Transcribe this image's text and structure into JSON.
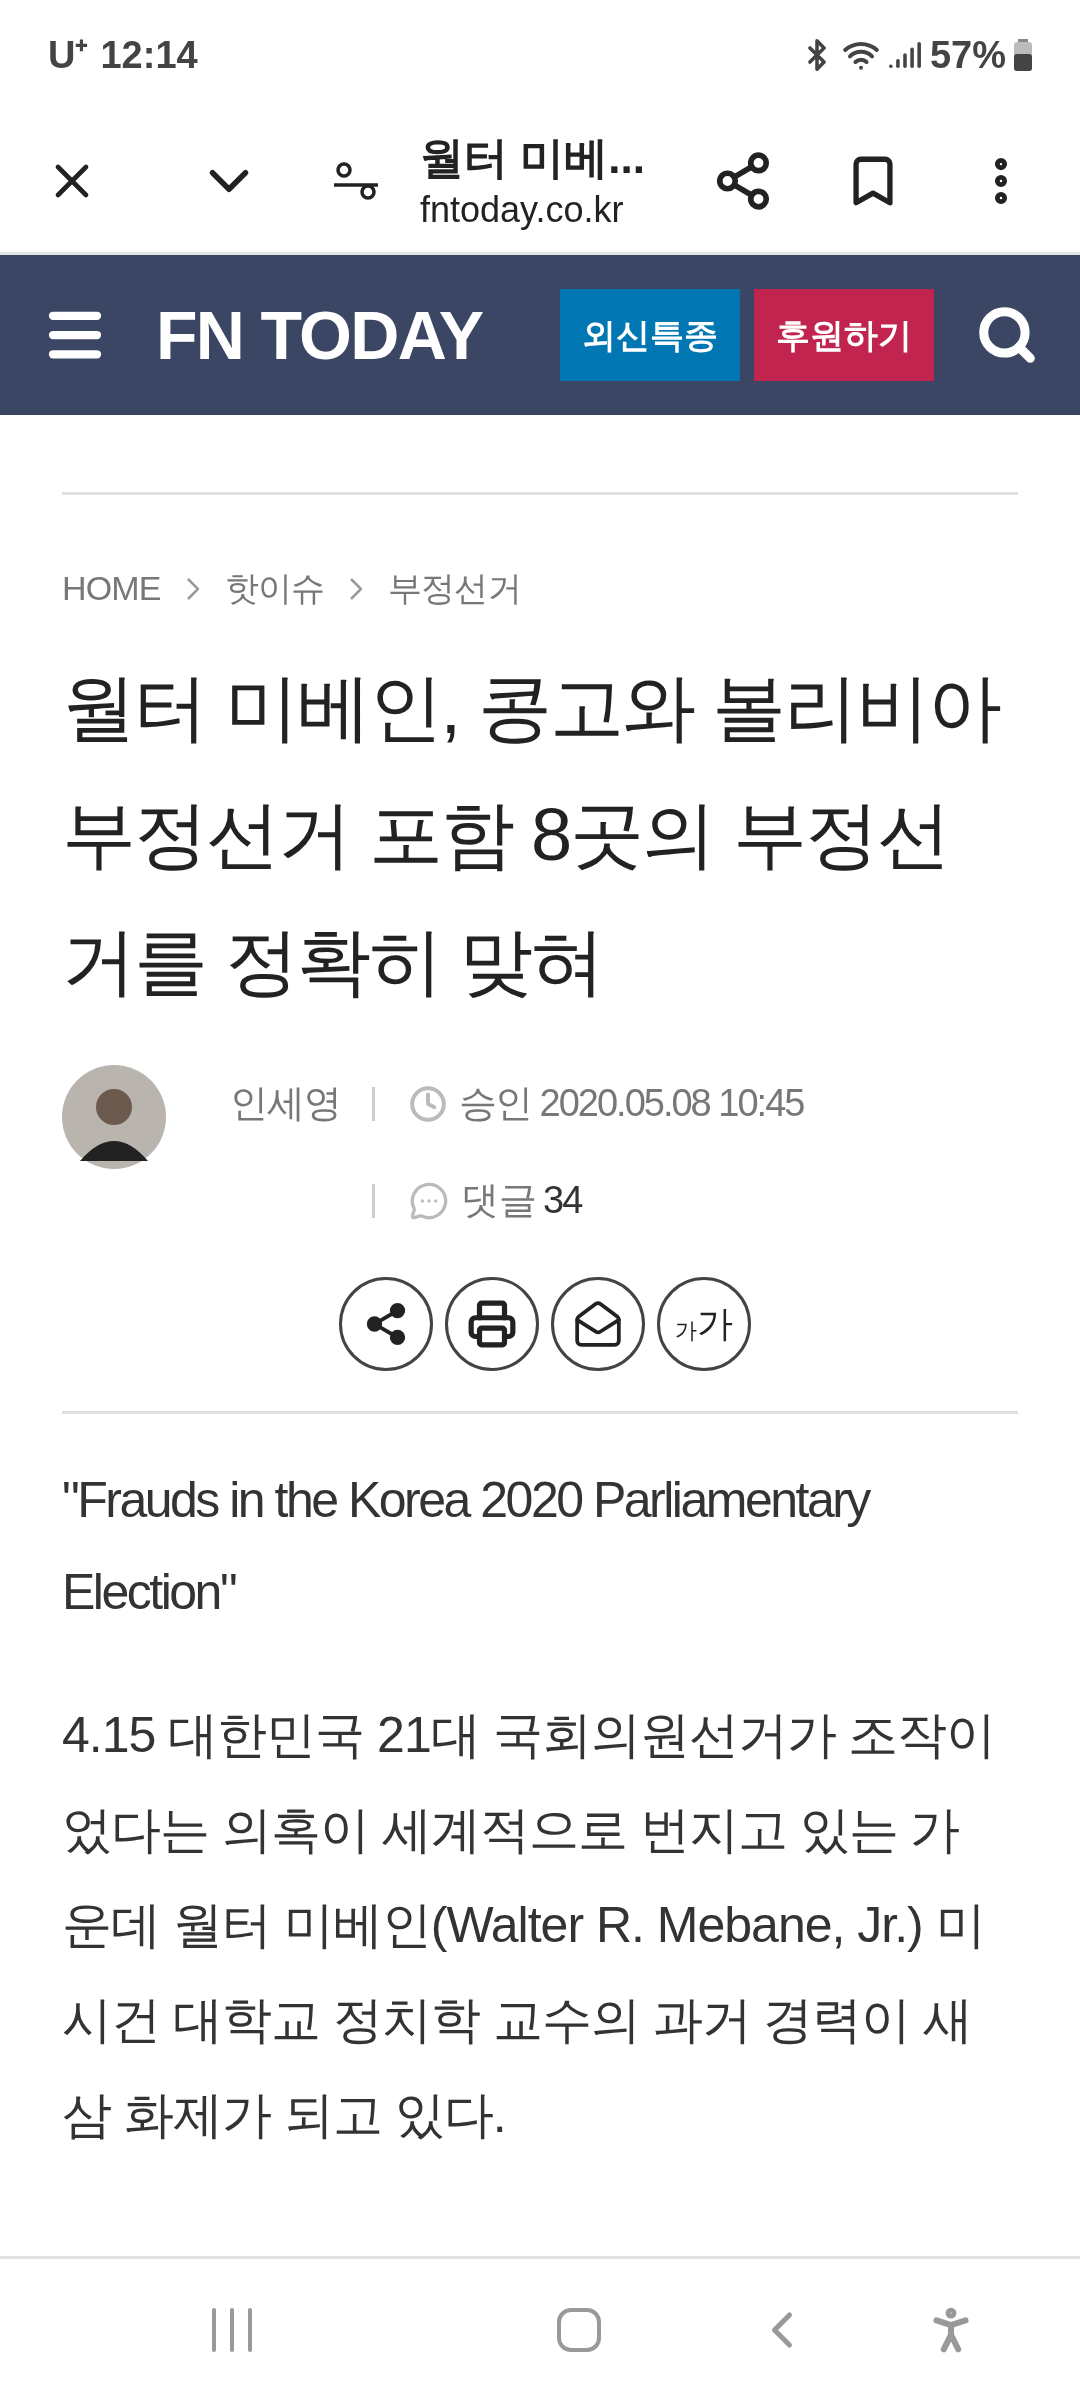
{
  "status_bar": {
    "carrier": "U⁺",
    "time": "12:14",
    "battery": "57%"
  },
  "browser_bar": {
    "title": "월터 미베...",
    "url": "fntoday.co.kr"
  },
  "site_header": {
    "logo": "FN TODAY",
    "buttons": [
      {
        "label": "외신특종",
        "color": "#0077b3"
      },
      {
        "label": "후원하기",
        "color": "#c1254f"
      }
    ]
  },
  "breadcrumb": [
    "HOME",
    "핫이슈",
    "부정선거"
  ],
  "article": {
    "title": "월터 미베인, 콩고와 볼리비아 부정선거 포함 8곳의 부정선거를 정확히 맞혀",
    "author": "인세영",
    "approved": "승인 2020.05.08 10:45",
    "comments_label": "댓글",
    "comments_count": "34",
    "font_button": {
      "small": "가",
      "large": "가"
    },
    "quote": "\"Frauds in the Korea 2020 Parliamentary Election\"",
    "body": "4.15 대한민국 21대 국회의원선거가 조작이었다는 의혹이 세계적으로 번지고 있는 가운데 월터 미베인(Walter R. Mebane, Jr.) 미시건 대학교 정치학 교수의 과거 경력이 새삼 화제가 되고 있다."
  }
}
